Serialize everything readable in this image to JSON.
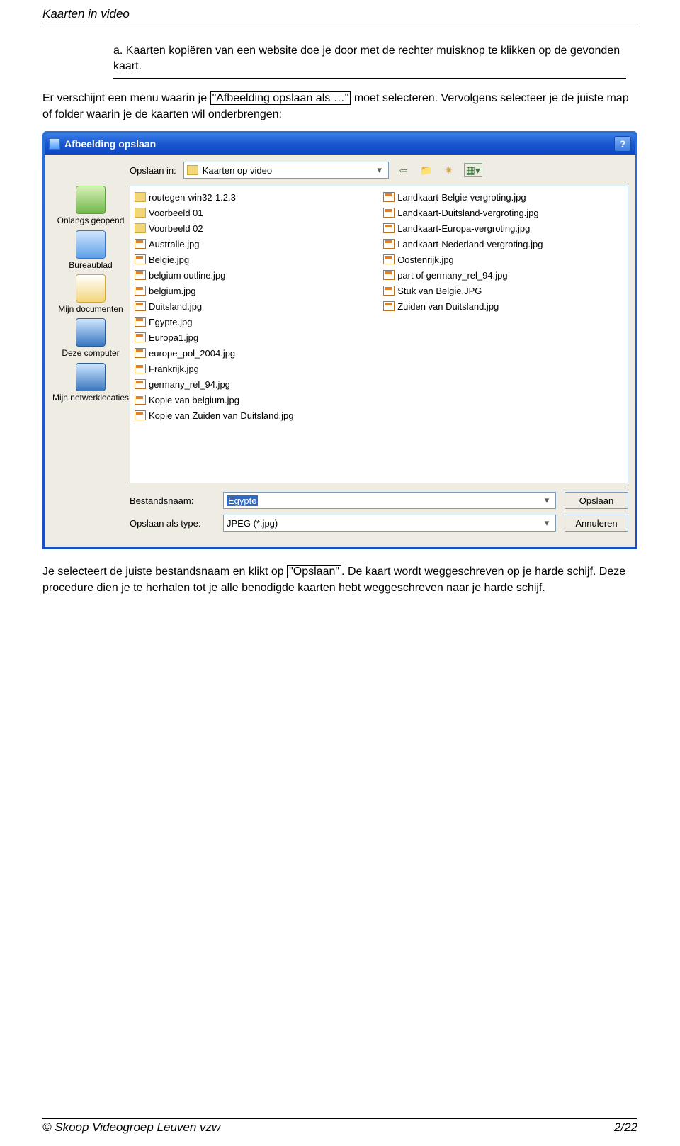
{
  "doc": {
    "header": "Kaarten in video",
    "section_a": "a. Kaarten kopiëren van een website doe je door met de rechter muisknop te klikken op de gevonden kaart.",
    "para1_before": "Er verschijnt een menu waarin je ",
    "para1_boxed": "\"Afbeelding opslaan als …\"",
    "para1_after": " moet selecteren. Vervolgens selecteer je de juiste map of folder waarin je de kaarten wil onderbrengen:",
    "para2_before": "Je selecteert de juiste bestandsnaam en klikt op ",
    "para2_boxed": "\"Opslaan\"",
    "para2_after": ". De kaart wordt weggeschreven op je harde schijf. Deze procedure dien je te herhalen tot je alle benodigde kaarten hebt weggeschreven naar je harde schijf.",
    "footer_left": "© Skoop Videogroep Leuven vzw",
    "footer_right": "2/22"
  },
  "dialog": {
    "title": "Afbeelding opslaan",
    "help": "?",
    "savein_label": "Opslaan in:",
    "savein_value": "Kaarten op video",
    "places": {
      "recent": "Onlangs geopend",
      "desktop": "Bureaublad",
      "docs": "Mijn documenten",
      "computer": "Deze computer",
      "network": "Mijn netwerklocaties"
    },
    "files_col1": [
      {
        "t": "folder",
        "n": "routegen-win32-1.2.3"
      },
      {
        "t": "folder",
        "n": "Voorbeeld 01"
      },
      {
        "t": "folder",
        "n": "Voorbeeld 02"
      },
      {
        "t": "file",
        "n": "Australie.jpg"
      },
      {
        "t": "file",
        "n": "Belgie.jpg"
      },
      {
        "t": "file",
        "n": "belgium outline.jpg"
      },
      {
        "t": "file",
        "n": "belgium.jpg"
      },
      {
        "t": "file",
        "n": "Duitsland.jpg"
      },
      {
        "t": "file",
        "n": "Egypte.jpg"
      },
      {
        "t": "file",
        "n": "Europa1.jpg"
      },
      {
        "t": "file",
        "n": "europe_pol_2004.jpg"
      },
      {
        "t": "file",
        "n": "Frankrijk.jpg"
      },
      {
        "t": "file",
        "n": "germany_rel_94.jpg"
      },
      {
        "t": "file",
        "n": "Kopie van belgium.jpg"
      },
      {
        "t": "file",
        "n": "Kopie van Zuiden van Duitsland.jpg"
      }
    ],
    "files_col2": [
      {
        "t": "file",
        "n": "Landkaart-Belgie-vergroting.jpg"
      },
      {
        "t": "file",
        "n": "Landkaart-Duitsland-vergroting.jpg"
      },
      {
        "t": "file",
        "n": "Landkaart-Europa-vergroting.jpg"
      },
      {
        "t": "file",
        "n": "Landkaart-Nederland-vergroting.jpg"
      },
      {
        "t": "file",
        "n": "Oostenrijk.jpg"
      },
      {
        "t": "file",
        "n": "part of germany_rel_94.jpg"
      },
      {
        "t": "file",
        "n": "Stuk van België.JPG"
      },
      {
        "t": "file",
        "n": "Zuiden van Duitsland.jpg"
      }
    ],
    "filename_label_pre": "Bestands",
    "filename_label_u": "n",
    "filename_label_post": "aam:",
    "filename_value": "Egypte",
    "filetype_label": "Opslaan als type:",
    "filetype_value": "JPEG (*.jpg)",
    "btn_save_u": "O",
    "btn_save_rest": "pslaan",
    "btn_cancel": "Annuleren"
  }
}
